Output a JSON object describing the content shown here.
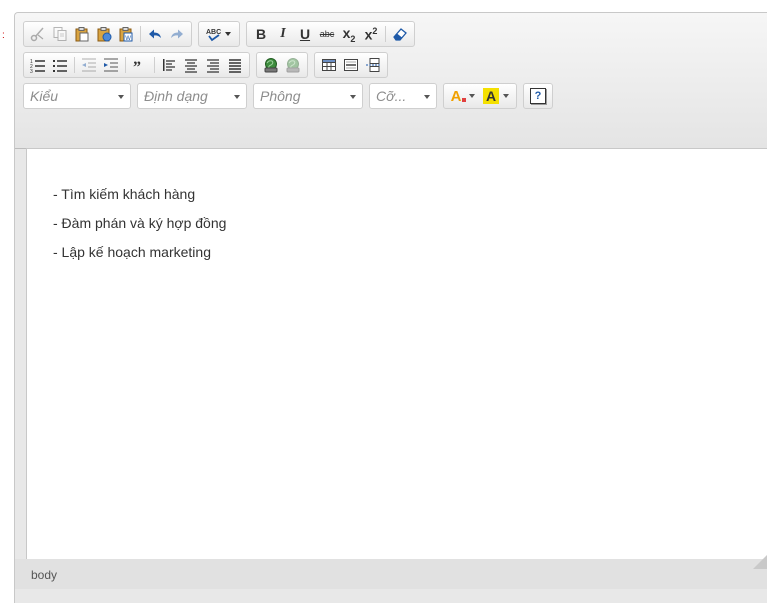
{
  "marker": ":",
  "toolbar": {
    "row1": {
      "spell_label": "ABC",
      "bold": "B",
      "italic": "I",
      "underline": "U",
      "strike": "abc",
      "subscript": "x",
      "subscript_index": "2",
      "superscript": "x",
      "superscript_index": "2"
    },
    "row3": {
      "style_combo": "Kiểu",
      "format_combo": "Định dạng",
      "font_combo": "Phông",
      "size_combo": "Cỡ...",
      "text_color_letter": "A",
      "bg_color_letter": "A",
      "help": "?"
    }
  },
  "content": {
    "lines": [
      "- Tìm kiếm khách hàng",
      "- Đàm phán và ký hợp đồng",
      "- Lập kế hoạch marketing"
    ]
  },
  "status": {
    "path": "body"
  },
  "colors": {
    "accent_yellow": "#f4e000",
    "icon_blue": "#1f5aa8",
    "icon_dark": "#333333"
  },
  "icons": [
    "cut-icon",
    "copy-icon",
    "paste-icon",
    "paste-text-icon",
    "paste-word-icon",
    "undo-icon",
    "redo-icon",
    "spellcheck-icon",
    "eraser-icon",
    "numbered-list-icon",
    "bullet-list-icon",
    "outdent-icon",
    "indent-icon",
    "blockquote-icon",
    "align-left-icon",
    "align-center-icon",
    "align-right-icon",
    "justify-icon",
    "link-icon",
    "unlink-icon",
    "table-icon",
    "horizontal-rule-icon",
    "page-break-icon"
  ]
}
